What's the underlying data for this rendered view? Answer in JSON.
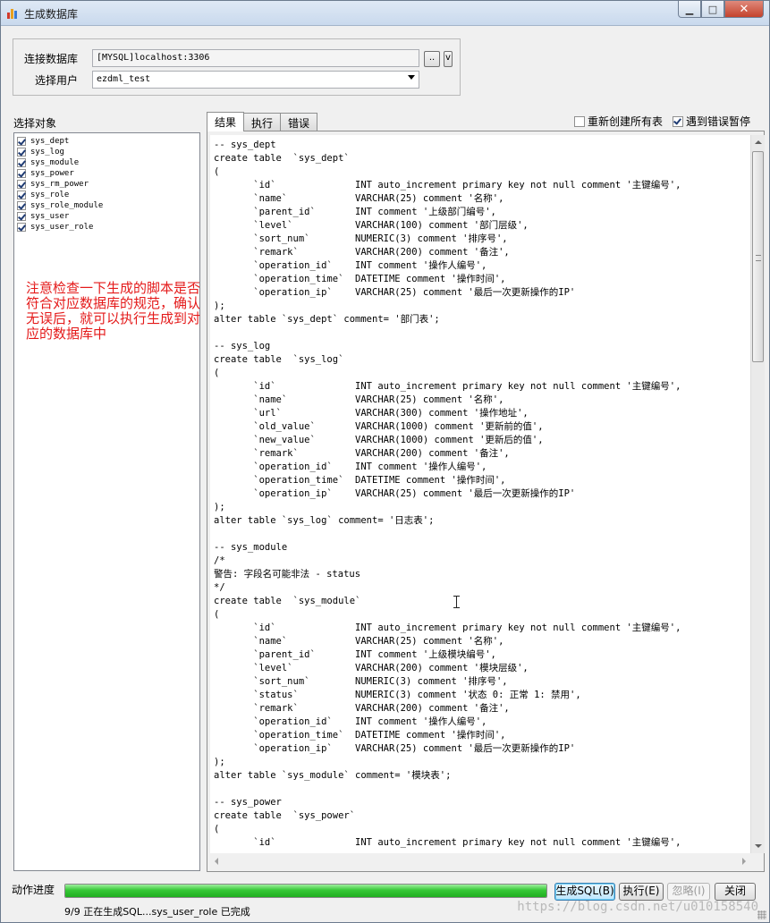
{
  "window": {
    "title": "生成数据库",
    "controls": {
      "minimize": "▁",
      "maximize": "□",
      "close": "✕"
    }
  },
  "connection": {
    "db_label": "连接数据库",
    "db_value": "[MYSQL]localhost:3306",
    "browse_label": "..",
    "menu_label": "v",
    "user_label": "选择用户",
    "user_value": "ezdml_test"
  },
  "objects": {
    "title": "选择对象",
    "items": [
      {
        "label": "sys_dept",
        "checked": true
      },
      {
        "label": "sys_log",
        "checked": true
      },
      {
        "label": "sys_module",
        "checked": true
      },
      {
        "label": "sys_power",
        "checked": true
      },
      {
        "label": "sys_rm_power",
        "checked": true
      },
      {
        "label": "sys_role",
        "checked": true
      },
      {
        "label": "sys_role_module",
        "checked": true
      },
      {
        "label": "sys_user",
        "checked": true
      },
      {
        "label": "sys_user_role",
        "checked": true
      }
    ]
  },
  "annotation": "注意检查一下生成的脚本是否符合对应数据库的规范，确认无误后，就可以执行生成到对应的数据库中",
  "tabs": [
    {
      "label": "结果",
      "active": true
    },
    {
      "label": "执行",
      "active": false
    },
    {
      "label": "错误",
      "active": false
    }
  ],
  "options": {
    "recreate_label": "重新创建所有表",
    "recreate_checked": false,
    "pause_on_error_label": "遇到错误暂停",
    "pause_on_error_checked": true
  },
  "result_text": "-- sys_dept\ncreate table  `sys_dept`\n(\n       `id`              INT auto_increment primary key not null comment '主键编号',\n       `name`            VARCHAR(25) comment '名称',\n       `parent_id`       INT comment '上级部门编号',\n       `level`           VARCHAR(100) comment '部门层级',\n       `sort_num`        NUMERIC(3) comment '排序号',\n       `remark`          VARCHAR(200) comment '备注',\n       `operation_id`    INT comment '操作人编号',\n       `operation_time`  DATETIME comment '操作时间',\n       `operation_ip`    VARCHAR(25) comment '最后一次更新操作的IP'\n);\nalter table `sys_dept` comment= '部门表';\n\n-- sys_log\ncreate table  `sys_log`\n(\n       `id`              INT auto_increment primary key not null comment '主键编号',\n       `name`            VARCHAR(25) comment '名称',\n       `url`             VARCHAR(300) comment '操作地址',\n       `old_value`       VARCHAR(1000) comment '更新前的值',\n       `new_value`       VARCHAR(1000) comment '更新后的值',\n       `remark`          VARCHAR(200) comment '备注',\n       `operation_id`    INT comment '操作人编号',\n       `operation_time`  DATETIME comment '操作时间',\n       `operation_ip`    VARCHAR(25) comment '最后一次更新操作的IP'\n);\nalter table `sys_log` comment= '日志表';\n\n-- sys_module\n/*\n警告: 字段名可能非法 - status\n*/\ncreate table  `sys_module`\n(\n       `id`              INT auto_increment primary key not null comment '主键编号',\n       `name`            VARCHAR(25) comment '名称',\n       `parent_id`       INT comment '上级模块编号',\n       `level`           VARCHAR(200) comment '模块层级',\n       `sort_num`        NUMERIC(3) comment '排序号',\n       `status`          NUMERIC(3) comment '状态 0: 正常 1: 禁用',\n       `remark`          VARCHAR(200) comment '备注',\n       `operation_id`    INT comment '操作人编号',\n       `operation_time`  DATETIME comment '操作时间',\n       `operation_ip`    VARCHAR(25) comment '最后一次更新操作的IP'\n);\nalter table `sys_module` comment= '模块表';\n\n-- sys_power\ncreate table  `sys_power`\n(\n       `id`              INT auto_increment primary key not null comment '主键编号',",
  "progress": {
    "label": "动作进度",
    "fraction": 1.0,
    "status": "9/9 正在生成SQL...sys_user_role 已完成"
  },
  "buttons": {
    "generate_sql": "生成SQL(B)",
    "execute": "执行(E)",
    "ignore": "忽略(I)",
    "close": "关闭"
  },
  "watermark": "https://blog.csdn.net/u010158540",
  "colors": {
    "annotation": "#e41a1a",
    "progress": "#37c837"
  }
}
